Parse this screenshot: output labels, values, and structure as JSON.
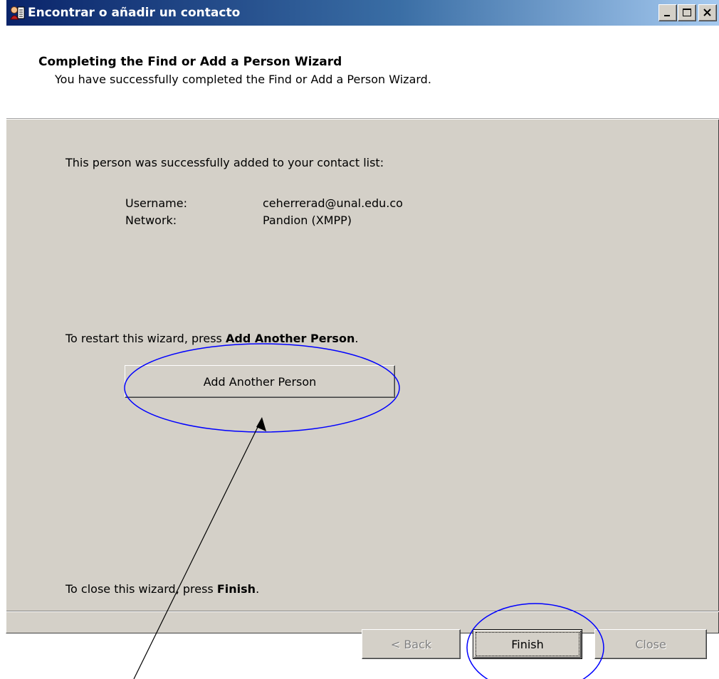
{
  "window": {
    "title": "Encontrar o añadir un contacto"
  },
  "header": {
    "title": "Completing the Find or Add a Person Wizard",
    "subtitle": "You have successfully completed the Find or Add a Person Wizard."
  },
  "body": {
    "success_message": "This person was successfully added to your contact list:",
    "details": [
      {
        "label": "Username:",
        "value": "ceherrerad@unal.edu.co"
      },
      {
        "label": "Network:",
        "value": "Pandion (XMPP)"
      }
    ],
    "restart_prefix": "To restart this wizard, press ",
    "restart_bold": "Add Another Person",
    "restart_suffix": ".",
    "add_another_label": "Add Another Person",
    "close_prefix": "To close this wizard, press ",
    "close_bold": "Finish",
    "close_suffix": "."
  },
  "footer": {
    "back_label": "< Back",
    "finish_label": "Finish",
    "close_label": "Close"
  },
  "colors": {
    "annotation": "#0000ff",
    "titlebar_start": "#0a246a",
    "titlebar_end": "#a6caf0"
  }
}
